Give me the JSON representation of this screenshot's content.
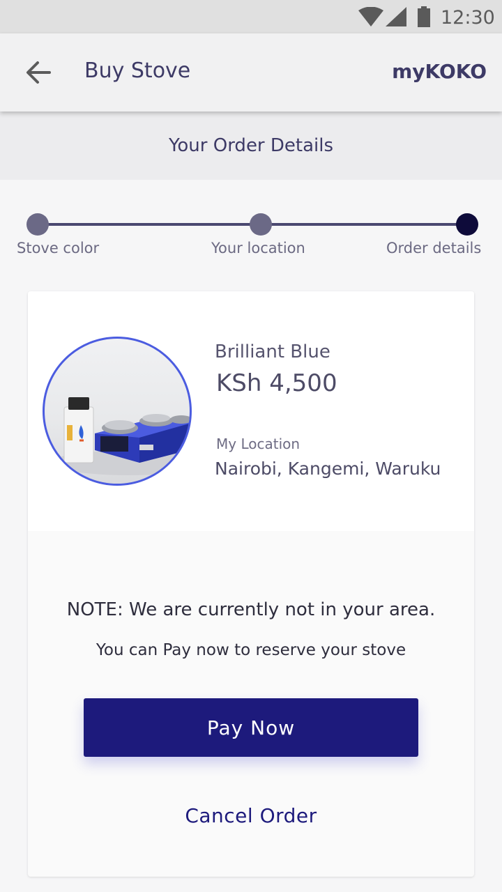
{
  "status_bar": {
    "time": "12:30",
    "icons": [
      "wifi-icon",
      "signal-icon",
      "battery-icon"
    ]
  },
  "app_bar": {
    "back_icon": "arrow-back-icon",
    "title": "Buy Stove",
    "brand": "myKOKO"
  },
  "section": {
    "title": "Your Order Details"
  },
  "stepper": {
    "steps": [
      {
        "label": "Stove color",
        "state": "done"
      },
      {
        "label": "Your location",
        "state": "done"
      },
      {
        "label": "Order details",
        "state": "active"
      }
    ]
  },
  "order": {
    "product_name": "Brilliant Blue",
    "price": "KSh 4,500",
    "location_label": "My Location",
    "location_value": "Nairobi, Kangemi, Waruku",
    "image_icon": "stove-product-image"
  },
  "notice": {
    "note": "NOTE: We are currently not in your area.",
    "subnote": "You can Pay now to reserve your stove"
  },
  "actions": {
    "pay_label": "Pay Now",
    "cancel_label": "Cancel Order"
  },
  "colors": {
    "primary": "#1d1a7c",
    "accent_ring": "#4b5ce0",
    "text": "#3d3a66",
    "step_done": "#6b6986",
    "step_active": "#0e0b3a"
  }
}
